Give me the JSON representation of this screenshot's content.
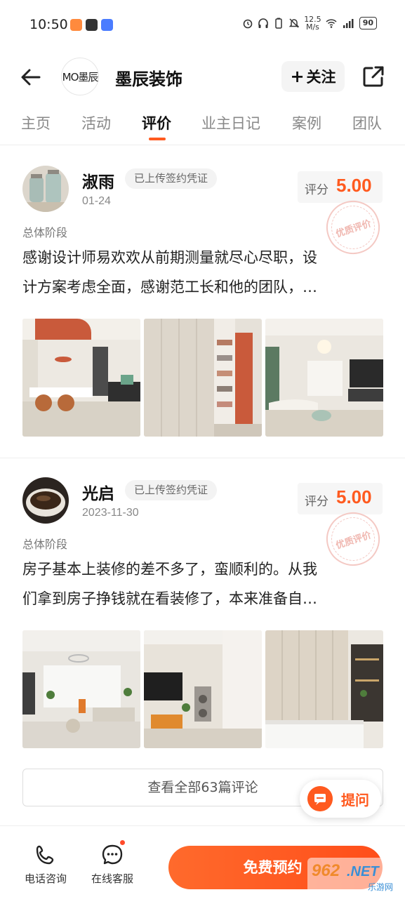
{
  "status_bar": {
    "time": "10:50",
    "net_speed_value": "12.5",
    "net_speed_unit": "M/s",
    "battery": "90"
  },
  "header": {
    "logo_text": "MO墨辰",
    "shop_name": "墨辰装饰",
    "follow_label": "关注",
    "follow_plus": "+"
  },
  "tabs": [
    {
      "label": "主页",
      "active": false
    },
    {
      "label": "活动",
      "active": false
    },
    {
      "label": "评价",
      "active": true
    },
    {
      "label": "业主日记",
      "active": false
    },
    {
      "label": "案例",
      "active": false
    },
    {
      "label": "团队",
      "active": false
    }
  ],
  "reviews": [
    {
      "author": "淑雨",
      "badge": "已上传签约凭证",
      "date": "01-24",
      "score_label": "评分",
      "score": "5.00",
      "stamp": "优质评价",
      "stage": "总体阶段",
      "text_line1": "感谢设计师易欢欢从前期测量就尽心尽职，设",
      "text_line2": "计方案考虑全面，感谢范工长和他的团队，…"
    },
    {
      "author": "光启",
      "badge": "已上传签约凭证",
      "date": "2023-11-30",
      "score_label": "评分",
      "score": "5.00",
      "stamp": "优质评价",
      "stage": "总体阶段",
      "text_line1": "房子基本上装修的差不多了，蛮顺利的。从我",
      "text_line2": "们拿到房子挣钱就在看装修了，本来准备自…"
    }
  ],
  "view_all_label": "查看全部63篇评论",
  "ask_label": "提问",
  "bottom_bar": {
    "phone_label": "电话咨询",
    "service_label": "在线客服",
    "book_label": "免费预约"
  },
  "watermark": {
    "main": "962.NET",
    "sub": "乐游网"
  },
  "colors": {
    "accent": "#ff5a1f",
    "badge_bg": "#f3f3f3",
    "score_bg": "#f6f6f6"
  }
}
